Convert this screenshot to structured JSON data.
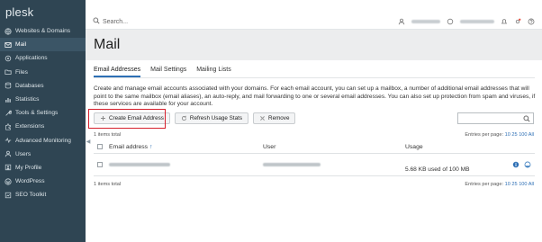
{
  "brand": "plesk",
  "sidebar": {
    "items": [
      {
        "label": "Websites & Domains",
        "icon": "globe-icon",
        "active": false
      },
      {
        "label": "Mail",
        "icon": "mail-icon",
        "active": true
      },
      {
        "label": "Applications",
        "icon": "applications-icon",
        "active": false
      },
      {
        "label": "Files",
        "icon": "folder-icon",
        "active": false
      },
      {
        "label": "Databases",
        "icon": "database-icon",
        "active": false
      },
      {
        "label": "Statistics",
        "icon": "statistics-icon",
        "active": false
      },
      {
        "label": "Tools & Settings",
        "icon": "tools-icon",
        "active": false
      },
      {
        "label": "Extensions",
        "icon": "extensions-icon",
        "active": false
      },
      {
        "label": "Advanced Monitoring",
        "icon": "monitoring-icon",
        "active": false
      },
      {
        "label": "Users",
        "icon": "users-icon",
        "active": false
      },
      {
        "label": "My Profile",
        "icon": "profile-icon",
        "active": false
      },
      {
        "label": "WordPress",
        "icon": "wordpress-icon",
        "active": false
      },
      {
        "label": "SEO Toolkit",
        "icon": "seo-icon",
        "active": false
      }
    ]
  },
  "topbar": {
    "search_placeholder": "Search..."
  },
  "page": {
    "title": "Mail"
  },
  "tabs": [
    {
      "label": "Email Addresses",
      "active": true
    },
    {
      "label": "Mail Settings",
      "active": false
    },
    {
      "label": "Mailing Lists",
      "active": false
    }
  ],
  "description": "Create and manage email accounts associated with your domains. For each email account, you can set up a mailbox, a number of additional email addresses that will point to the same mailbox (email aliases), an auto-reply, and mail forwarding to one or several email addresses. You can also set up protection from spam and viruses, if these services are available for your account.",
  "toolbar": {
    "create_label": "Create Email Address",
    "refresh_label": "Refresh Usage Stats",
    "remove_label": "Remove"
  },
  "list": {
    "items_total": "1 items total",
    "entries_label": "Entries per page:",
    "entries_options": [
      "10",
      "25",
      "100",
      "All"
    ],
    "columns": {
      "email": "Email address",
      "user": "User",
      "usage": "Usage"
    },
    "rows": [
      {
        "usage": "5.68 KB used of 100 MB"
      }
    ]
  },
  "colors": {
    "sidebar_bg": "#2f4553",
    "accent": "#2d6fb5",
    "highlight": "#d61f2c"
  }
}
